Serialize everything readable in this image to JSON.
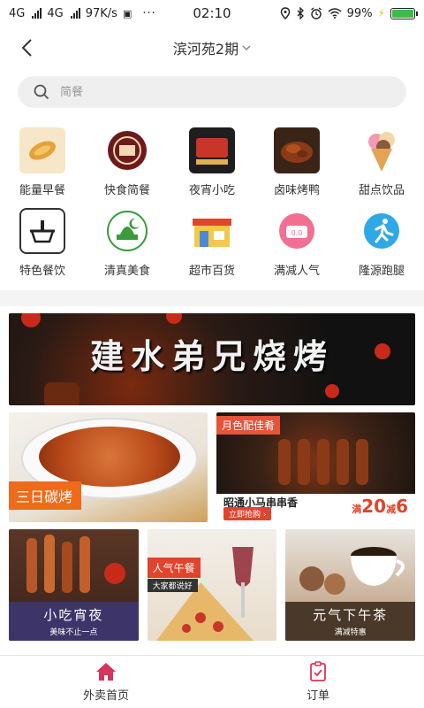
{
  "status_bar": {
    "network1": "4G",
    "network2": "4G",
    "speed": "97K/s",
    "time": "02:10",
    "battery": "99%",
    "battery_level": 0.99
  },
  "header": {
    "location": "滨河苑2期"
  },
  "search": {
    "placeholder": "简餐"
  },
  "categories": [
    {
      "label": "能量早餐",
      "icon": "fried-dough-icon"
    },
    {
      "label": "快食简餐",
      "icon": "fast-food-logo-icon"
    },
    {
      "label": "夜宵小吃",
      "icon": "night-snack-icon"
    },
    {
      "label": "卤味烤鸭",
      "icon": "roast-duck-icon"
    },
    {
      "label": "甜点饮品",
      "icon": "ice-cream-icon"
    },
    {
      "label": "特色餐饮",
      "icon": "hotpot-icon"
    },
    {
      "label": "清真美食",
      "icon": "mosque-icon"
    },
    {
      "label": "超市百货",
      "icon": "supermarket-icon"
    },
    {
      "label": "满减人气",
      "icon": "tmall-cat-icon"
    },
    {
      "label": "隆源跑腿",
      "icon": "runner-icon"
    }
  ],
  "banners": {
    "hero_title": "建水弟兄烧烤",
    "left_promo_tag": "三日碳烤",
    "right_promo_tag": "月色配佳肴",
    "right_promo_shop": "昭通小马串串香",
    "right_promo_button": "立即抢购 ›",
    "discount_prefix": "满",
    "discount_amount": "20",
    "discount_mid": "减",
    "discount_value": "6",
    "tiles": [
      {
        "title": "小吃宵夜",
        "subtitle": "美味不止一点"
      },
      {
        "tag": "人气午餐",
        "tag_sub": "大家都说好"
      },
      {
        "title": "元气下午茶",
        "subtitle": "满减特惠"
      }
    ]
  },
  "tabbar": {
    "home": "外卖首页",
    "orders": "订单"
  },
  "colors": {
    "accent_red": "#e0442b",
    "tab_icon_red": "#d6355a",
    "orange_tag": "#f06a1c",
    "night_caption": "#3d3569"
  }
}
